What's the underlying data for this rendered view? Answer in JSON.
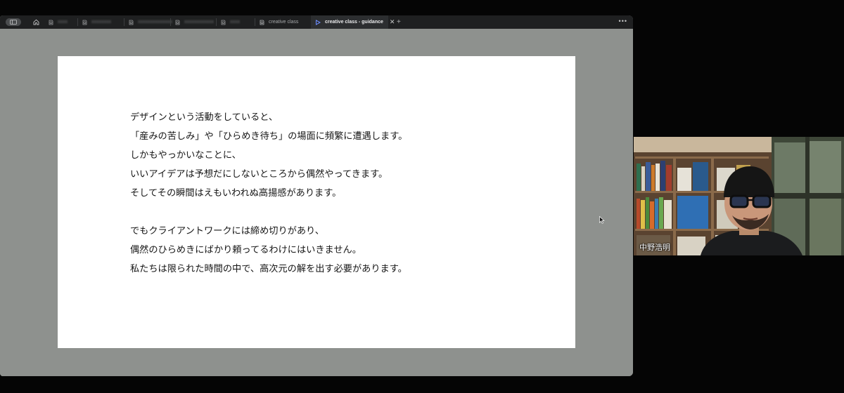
{
  "tabs": [
    {
      "label": "xxxx",
      "blurred": true
    },
    {
      "label": "xxxxxxxx",
      "blurred": true
    },
    {
      "label": "xxxxxxxxxxxxxx",
      "blurred": true
    },
    {
      "label": "xxxxxxxxxxxx",
      "blurred": true
    },
    {
      "label": "xxxx",
      "blurred": true
    },
    {
      "label": "creative class",
      "blurred": false
    },
    {
      "label": "creative class - guidance",
      "blurred": false,
      "active": true
    }
  ],
  "slide": {
    "lines": [
      "デザインという活動をしていると、",
      "「産みの苦しみ」や「ひらめき待ち」の場面に頻繁に遭遇します。",
      "しかもやっかいなことに、",
      "いいアイデアは予想だにしないところから偶然やってきます。",
      "そしてその瞬間はえもいわれぬ高揚感があります。",
      "",
      "でもクライアントワークには締め切りがあり、",
      "偶然のひらめきにばかり頼ってるわけにはいきません。",
      "私たちは限られた時間の中で、高次元の解を出す必要があります。"
    ]
  },
  "webcam": {
    "participant_name": "中野浩明"
  },
  "icons": {
    "sidebar": "sidebar-toggle-icon",
    "home": "home-icon",
    "tab": "notion-page-icon",
    "active_tab": "play-triangle-icon",
    "close": "close-icon",
    "new_tab": "plus-icon",
    "more": "more-horizontal-icon"
  },
  "colors": {
    "tabbar_bg": "#1f2021",
    "canvas_bg": "#8e918e",
    "slide_bg": "#ffffff",
    "active_tab_icon": "#6b8cff"
  }
}
